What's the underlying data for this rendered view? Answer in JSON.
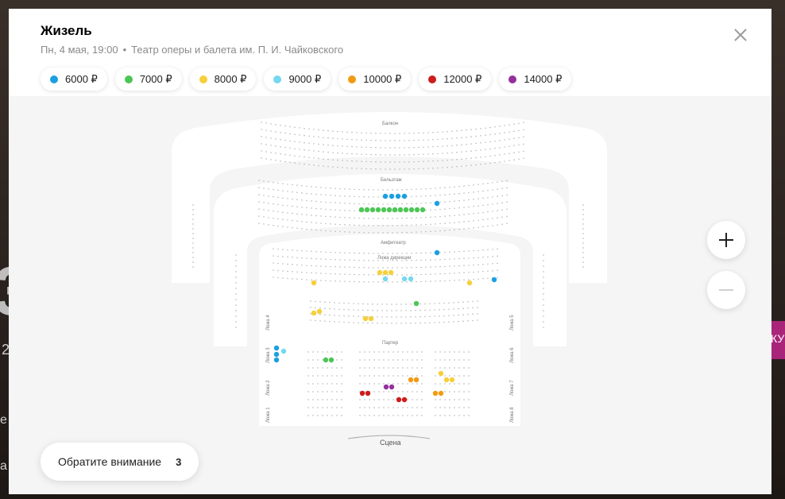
{
  "background": {
    "digit": "3",
    "num": "2",
    "e": "е",
    "a": "а",
    "promo": "КУ"
  },
  "event": {
    "title": "Жизель",
    "datetime": "Пн, 4 мая, 19:00",
    "separator": "•",
    "venue": "Театр оперы и балета им. П. И. Чайковского"
  },
  "prices": [
    {
      "label": "6000 ₽",
      "color": "#1aa0e0"
    },
    {
      "label": "7000 ₽",
      "color": "#4cc654"
    },
    {
      "label": "8000 ₽",
      "color": "#f6cf3a"
    },
    {
      "label": "9000 ₽",
      "color": "#76d8ee"
    },
    {
      "label": "10000 ₽",
      "color": "#f29a11"
    },
    {
      "label": "12000 ₽",
      "color": "#cc1d1d"
    },
    {
      "label": "14000 ₽",
      "color": "#93309c"
    }
  ],
  "hall": {
    "balcony": "Балкон",
    "beletage": "Бельэтаж",
    "amphitheater": "Амфитеатр",
    "royal_box": "Ложа дирекции",
    "parterre": "Партер",
    "stage": "Сцена",
    "boxes_left": [
      "Ложа 4",
      "Ложа 3",
      "Ложа 2",
      "Ложа 1"
    ],
    "boxes_right": [
      "Ложа 5",
      "Ложа 6",
      "Ложа 7",
      "Ложа 8"
    ]
  },
  "notice": {
    "label": "Обратите внимание",
    "count": "3"
  },
  "icons": {
    "close": "close-icon",
    "zoom_in": "plus-icon",
    "zoom_out": "minus-icon"
  }
}
